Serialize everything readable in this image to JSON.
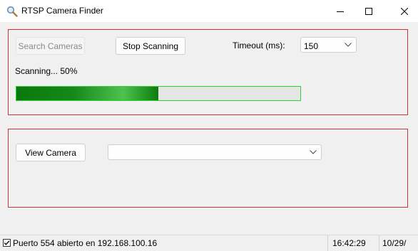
{
  "window": {
    "title": "RTSP Camera Finder",
    "icon": "magnifier-icon"
  },
  "scan_panel": {
    "search_button": "Search Cameras",
    "stop_button": "Stop Scanning",
    "timeout_label": "Timeout (ms):",
    "timeout_value": "150",
    "status_text": "Scanning... 50%",
    "progress_percent": 50
  },
  "view_panel": {
    "view_button": "View Camera",
    "camera_select_value": ""
  },
  "statusbar": {
    "message": "Puerto 554 abierto en 192.168.100.16",
    "time": "16:42:29",
    "date": "10/29/"
  },
  "colors": {
    "accent_border": "#c8343a",
    "progress_fill": "#0c780c",
    "progress_border": "#2fd12f"
  }
}
